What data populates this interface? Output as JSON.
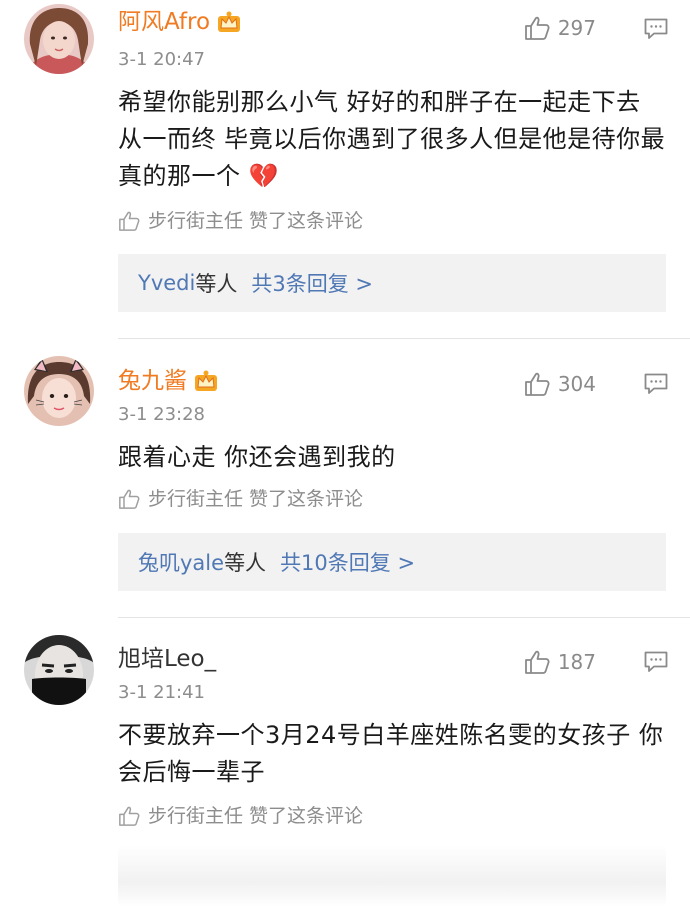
{
  "comments": [
    {
      "username": "阿风Afro",
      "vip": true,
      "time": "3-1 20:47",
      "text": "希望你能别那么小气 好好的和胖子在一起走下去 从一而终 毕竟以后你遇到了很多人但是他是待你最真的那一个 💔",
      "likes": "297",
      "liked_by": "步行街主任 赞了这条评论",
      "replies": {
        "names": "Yvedi",
        "who": "等人",
        "count": "共3条回复 >"
      }
    },
    {
      "username": "兔九酱",
      "vip": true,
      "time": "3-1 23:28",
      "text": "跟着心走  你还会遇到我的",
      "likes": "304",
      "liked_by": "步行街主任 赞了这条评论",
      "replies": {
        "names": "兔叽yale",
        "who": "等人",
        "count": "共10条回复 >"
      }
    },
    {
      "username": "旭培Leo_",
      "vip": false,
      "time": "3-1 21:41",
      "text": "不要放弃一个3月24号白羊座姓陈名雯的女孩子 你会后悔一辈子",
      "likes": "187",
      "liked_by": "步行街主任 赞了这条评论"
    }
  ],
  "colors": {
    "vip_name": "#f07b22",
    "reply_link": "#4f78b5",
    "meta": "#8d8d8d"
  },
  "icons": [
    "vip-crown-icon",
    "thumbs-up-icon",
    "comment-icon",
    "broken-heart-emoji"
  ]
}
